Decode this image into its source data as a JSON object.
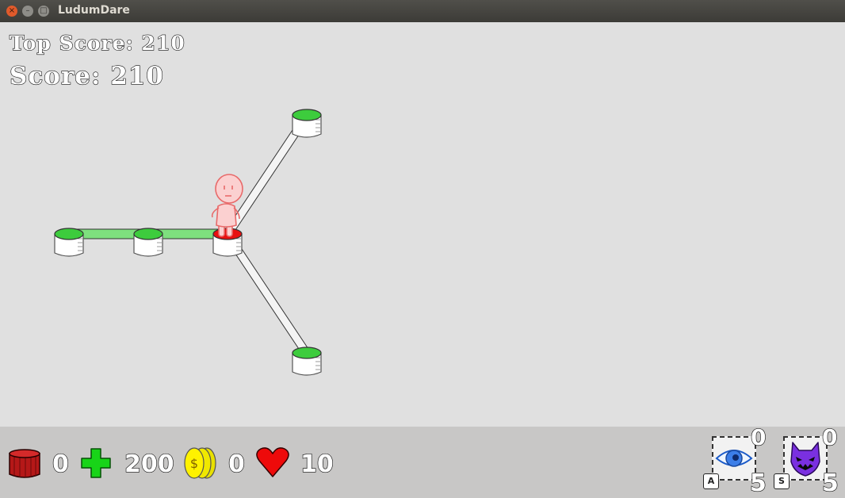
{
  "window": {
    "title": "LudumDare",
    "close_glyph": "×",
    "min_glyph": "–",
    "max_glyph": "□"
  },
  "scores": {
    "top_score": "Top Score: 210",
    "score": "Score: 210"
  },
  "hud": {
    "barrels": "0",
    "health_plus": "200",
    "coins": "0",
    "lives": "10",
    "eye_ability": {
      "charges": "0",
      "key": "A",
      "count": "5",
      "icon": "eye-icon"
    },
    "demon_ability": {
      "charges": "0",
      "key": "S",
      "count": "5",
      "icon": "demon-mask-icon"
    }
  },
  "colors": {
    "active_pad": "#e81010",
    "pad": "#3dcc3d",
    "walked_path": "#7ee07e",
    "background": "#e0e0e0",
    "hud": "#c8c7c6"
  }
}
